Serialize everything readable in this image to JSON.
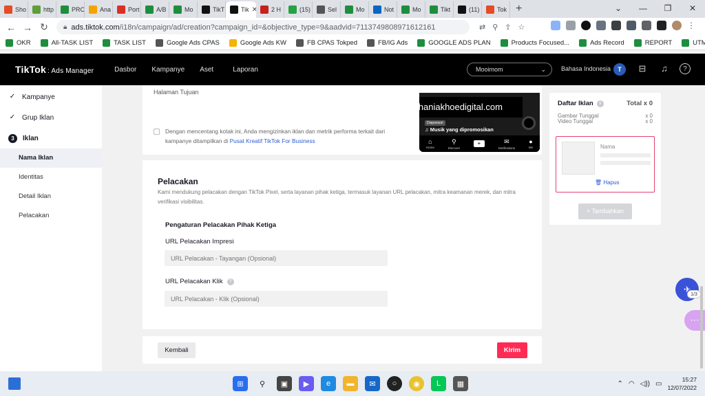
{
  "browser": {
    "tabs": [
      {
        "label": "Sho",
        "color": "#e34c26"
      },
      {
        "label": "http",
        "color": "#5f9e3a"
      },
      {
        "label": "PRC",
        "color": "#1e8e3e"
      },
      {
        "label": "Ana",
        "color": "#f4a400"
      },
      {
        "label": "Port",
        "color": "#d93025"
      },
      {
        "label": "A/B",
        "color": "#1e8e3e"
      },
      {
        "label": "Mo",
        "color": "#1e8e3e"
      },
      {
        "label": "TikT",
        "color": "#111111"
      },
      {
        "label": "Tik",
        "color": "#111111",
        "active": true
      },
      {
        "label": "2 H",
        "color": "#c5221f"
      },
      {
        "label": "(15)",
        "color": "#25a244"
      },
      {
        "label": "Sel",
        "color": "#555555"
      },
      {
        "label": "Mo",
        "color": "#1e8e3e"
      },
      {
        "label": "Not",
        "color": "#0a66c2"
      },
      {
        "label": "Mo",
        "color": "#1e8e3e"
      },
      {
        "label": "Tikt",
        "color": "#1e8e3e"
      },
      {
        "label": "(11)",
        "color": "#111111"
      },
      {
        "label": "Tok",
        "color": "#e34c26"
      }
    ],
    "new_tab": "+",
    "url_host": "ads.tiktok.com",
    "url_path": "/i18n/campaign/ad/creation?campaign_id=&objective_type=9&aadvid=7113749808971612161",
    "bookmarks": [
      {
        "label": "OKR",
        "color": "#1e8e3e"
      },
      {
        "label": "All-TASK LIST",
        "color": "#1e8e3e"
      },
      {
        "label": "TASK LIST",
        "color": "#1e8e3e"
      },
      {
        "label": "Google Ads CPAS",
        "color": "#555555"
      },
      {
        "label": "Google Ads KW",
        "color": "#f4b400"
      },
      {
        "label": "FB CPAS Tokped",
        "color": "#555555"
      },
      {
        "label": "FB/IG Ads",
        "color": "#555555"
      },
      {
        "label": "GOOGLE ADS PLAN",
        "color": "#1e8e3e"
      },
      {
        "label": "Products Focused...",
        "color": "#1e8e3e"
      },
      {
        "label": "Ads Record",
        "color": "#1e8e3e"
      },
      {
        "label": "REPORT",
        "color": "#1e8e3e"
      },
      {
        "label": "UTM",
        "color": "#1e8e3e"
      }
    ]
  },
  "header": {
    "logo": "TikTok",
    "logo_suffix": ": Ads Manager",
    "nav": [
      "Dasbor",
      "Kampanye",
      "Aset",
      "Laporan"
    ],
    "account": "Mooimom",
    "language": "Bahasa Indonesia",
    "avatar_initial": "T"
  },
  "sidebar": {
    "steps": [
      {
        "label": "Kampanye",
        "state": "done"
      },
      {
        "label": "Grup Iklan",
        "state": "done"
      },
      {
        "label": "Iklan",
        "state": "current",
        "number": "3"
      }
    ],
    "subitems": [
      {
        "label": "Nama Iklan",
        "active": true
      },
      {
        "label": "Identitas"
      },
      {
        "label": "Detail Iklan"
      },
      {
        "label": "Pelacakan"
      }
    ]
  },
  "top_card": {
    "destination_label": "Halaman Tujuan",
    "consent_text": "Dengan mencentang kotak ini, Anda mengizinkan iklan dan metrik performa terkait dari kampanye ditampilkan di ",
    "consent_link": "Pusat Kreatif TikTok For Business"
  },
  "preview": {
    "watermark": "www.thaniakhoedigital.com",
    "tag": "Disponsori",
    "music": "♫ Musik yang dipromosikan",
    "nav": [
      "Home",
      "Discover",
      "",
      "Notifications",
      "Me"
    ],
    "notif_count": "9"
  },
  "tracking": {
    "title": "Pelacakan",
    "description": "Kami mendukung pelacakan dengan TikTok Pixel, serta layanan pihak ketiga, termasuk layanan URL pelacakan, mitra keamanan merek, dan mitra verifikasi visibilitas.",
    "third_party_title": "Pengaturan Pelacakan Pihak Ketiga",
    "impression_label": "URL Pelacakan Impresi",
    "impression_placeholder": "URL Pelacakan - Tayangan (Opsional)",
    "click_label": "URL Pelacakan Klik",
    "click_placeholder": "URL Pelacakan - Klik (Opsional)"
  },
  "footer": {
    "back": "Kembali",
    "submit": "Kirim"
  },
  "ad_list": {
    "title": "Daftar Iklan",
    "total": "Total x 0",
    "rows": [
      {
        "label": "Gambar Tunggal",
        "count": "x 0"
      },
      {
        "label": "Video Tunggal",
        "count": "x 0"
      }
    ],
    "name_label": "Nama",
    "delete": "Hapus",
    "add": "+ Tambahkan"
  },
  "floating": {
    "badge": "1/3"
  },
  "taskbar": {
    "time": "15:27",
    "date": "12/07/2022"
  }
}
